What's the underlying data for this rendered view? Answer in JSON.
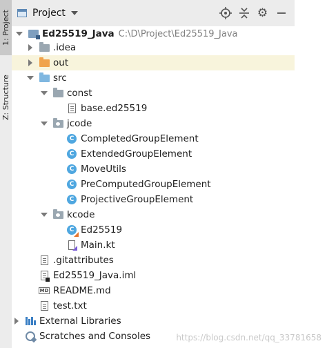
{
  "side_tabs": {
    "project": "1: Project",
    "structure": "Z: Structure"
  },
  "header": {
    "title": "Project",
    "tools": [
      "locate-icon",
      "collapse-icon",
      "gear-icon",
      "minimize-icon"
    ]
  },
  "tree": [
    {
      "id": "root",
      "label": "Ed25519_Java",
      "path": "C:\\D\\Project\\Ed25519_Java",
      "icon": "project-folder-icon",
      "expanded": true
    },
    {
      "id": "idea",
      "label": ".idea",
      "icon": "folder-icon",
      "expanded": false
    },
    {
      "id": "out",
      "label": "out",
      "icon": "excluded-folder-icon",
      "expanded": false,
      "highlighted": true
    },
    {
      "id": "src",
      "label": "src",
      "icon": "source-folder-icon",
      "expanded": true
    },
    {
      "id": "const",
      "label": "const",
      "icon": "folder-icon",
      "expanded": true
    },
    {
      "id": "base",
      "label": "base.ed25519",
      "icon": "file-icon"
    },
    {
      "id": "jcode",
      "label": "jcode",
      "icon": "package-icon",
      "expanded": true
    },
    {
      "id": "completed",
      "label": "CompletedGroupElement",
      "icon": "class-icon"
    },
    {
      "id": "extended",
      "label": "ExtendedGroupElement",
      "icon": "class-icon"
    },
    {
      "id": "moveutils",
      "label": "MoveUtils",
      "icon": "class-icon"
    },
    {
      "id": "precomputed",
      "label": "PreComputedGroupElement",
      "icon": "class-icon"
    },
    {
      "id": "projective",
      "label": "ProjectiveGroupElement",
      "icon": "class-icon"
    },
    {
      "id": "kcode",
      "label": "kcode",
      "icon": "package-icon",
      "expanded": true
    },
    {
      "id": "ed25519",
      "label": "Ed25519",
      "icon": "kotlin-class-icon"
    },
    {
      "id": "mainkt",
      "label": "Main.kt",
      "icon": "kotlin-file-icon"
    },
    {
      "id": "gitattributes",
      "label": ".gitattributes",
      "icon": "file-icon"
    },
    {
      "id": "iml",
      "label": "Ed25519_Java.iml",
      "icon": "module-file-icon"
    },
    {
      "id": "readme",
      "label": "README.md",
      "icon": "markdown-file-icon",
      "badge": "MD"
    },
    {
      "id": "testtxt",
      "label": "test.txt",
      "icon": "file-icon"
    },
    {
      "id": "extlibs",
      "label": "External Libraries",
      "icon": "libraries-icon",
      "expanded": false
    },
    {
      "id": "scratches",
      "label": "Scratches and Consoles",
      "icon": "scratches-icon"
    }
  ],
  "watermark": "https://blog.csdn.net/qq_33781658"
}
